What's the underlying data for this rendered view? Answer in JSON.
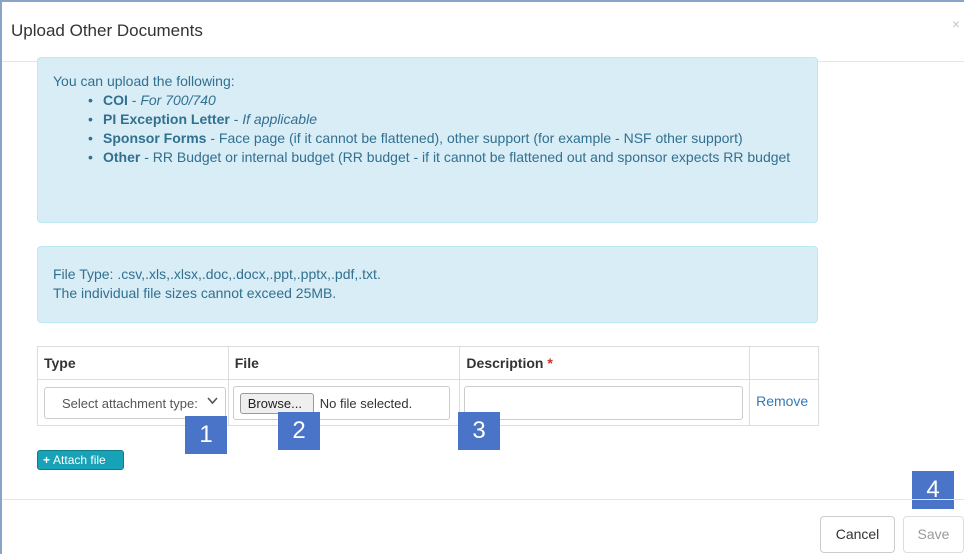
{
  "modal": {
    "title": "Upload Other Documents",
    "close_glyph": "×"
  },
  "info": {
    "intro": "You can upload the following:",
    "items": [
      {
        "bold": "COI",
        "sep": " - ",
        "text": "For 700/740",
        "italic": true
      },
      {
        "bold": "PI Exception Letter",
        "sep": " - ",
        "text": "If applicable",
        "italic": true
      },
      {
        "bold": "Sponsor Forms",
        "sep": " - ",
        "text": "Face page (if it cannot be flattened), other support (for example - NSF other support)",
        "italic": false
      },
      {
        "bold": "Other",
        "sep": " - ",
        "text": "RR Budget or internal budget (RR budget - if it cannot be flattened out and sponsor expects RR budget",
        "italic": false
      }
    ]
  },
  "file_info": {
    "line1": "File Type: .csv,.xls,.xlsx,.doc,.docx,.ppt,.pptx,.pdf,.txt.",
    "line2": "The individual file sizes cannot exceed 25MB."
  },
  "table": {
    "headers": {
      "type": "Type",
      "file": "File",
      "description": "Description",
      "required_mark": "*"
    },
    "row": {
      "select_value": "Select attachment type:",
      "browse_label": "Browse...",
      "no_file": "No file selected.",
      "description_value": "",
      "remove_label": "Remove"
    }
  },
  "badges": [
    "1",
    "2",
    "3",
    "4"
  ],
  "attach_button": {
    "plus": "+",
    "label": "Attach file"
  },
  "footer": {
    "cancel_label": "Cancel",
    "save_label": "Save"
  },
  "colors": {
    "accent_badge": "#4a74c8",
    "alert_bg": "#d9edf7",
    "attach_btn": "#17a2b8",
    "link": "#337ab7"
  }
}
